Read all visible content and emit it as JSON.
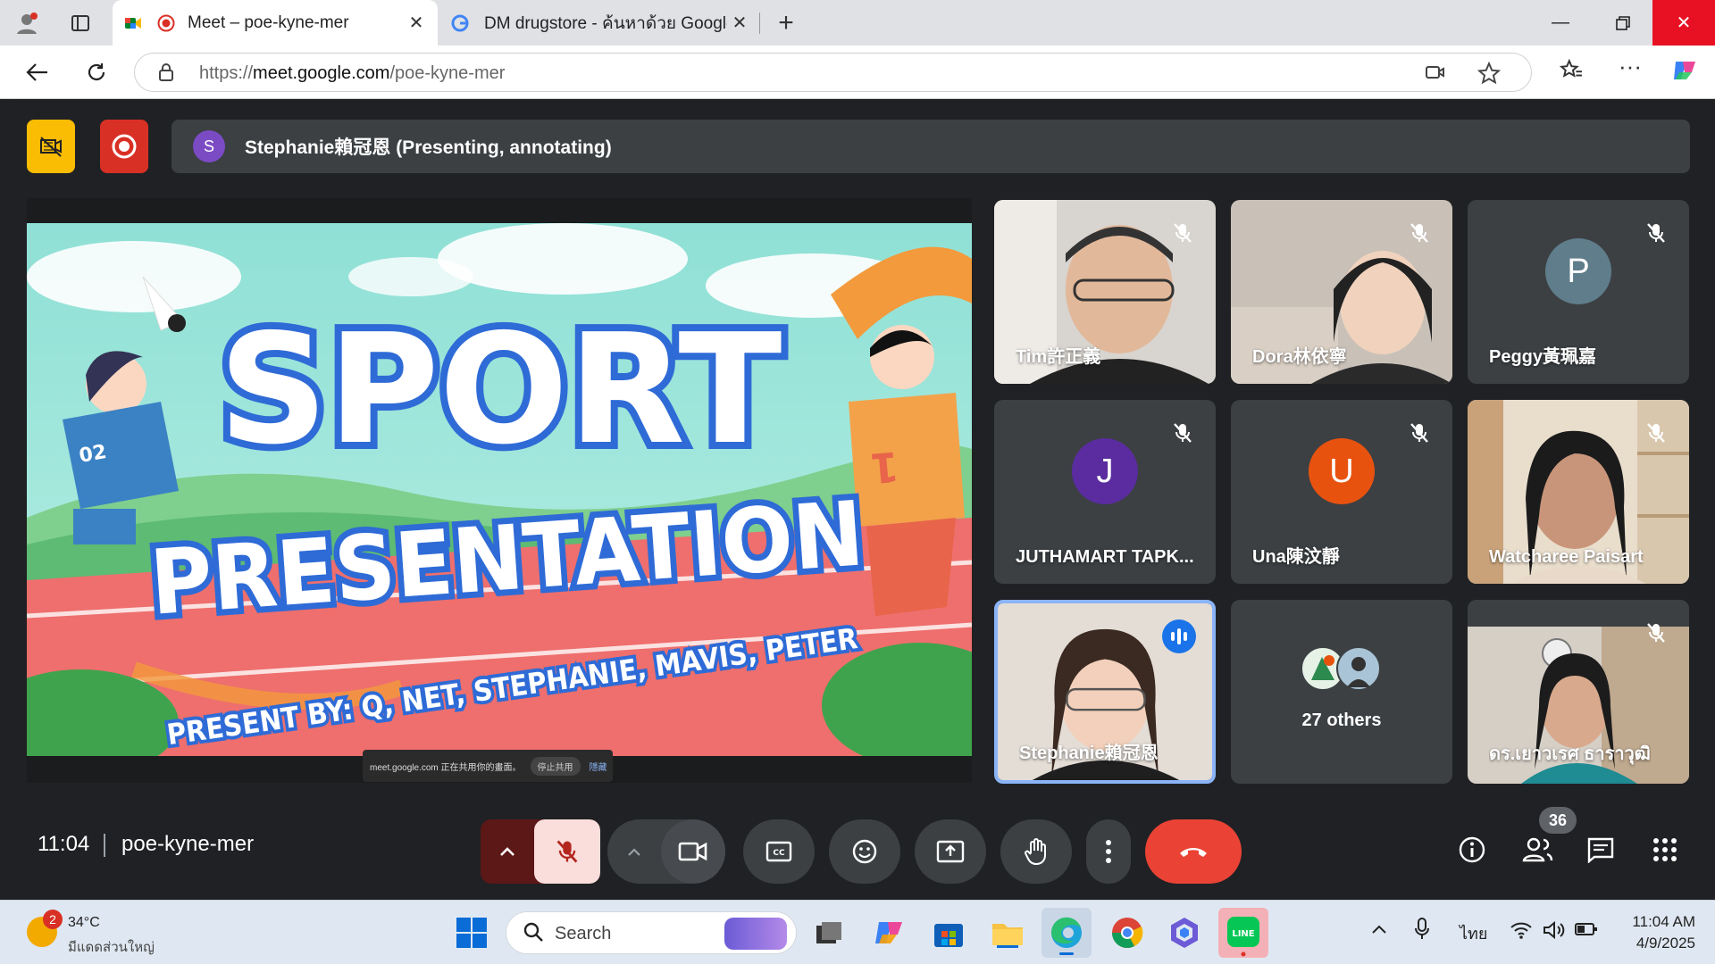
{
  "browser": {
    "tabs": [
      {
        "title": "Meet – poe-kyne-mer",
        "active": true
      },
      {
        "title": "DM drugstore - ค้นหาด้วย Google",
        "active": false
      }
    ],
    "url_prefix": "https://",
    "url_host": "meet.google.com",
    "url_path": "/poe-kyne-mer"
  },
  "meet": {
    "presenter_initial": "S",
    "presenter_text": "Stephanie賴冠恩 (Presenting, annotating)",
    "slide": {
      "title_line1": "SPORT",
      "title_line2": "PRESENTATION",
      "subtitle": "PRESENT BY: Q, NET, STEPHANIE, MAVIS, PETER",
      "bib_left": "02",
      "bib_right": "1"
    },
    "share_banner": {
      "text": "meet.google.com 正在共用你的畫面。",
      "stop": "停止共用",
      "hide": "隱藏"
    },
    "participants": [
      {
        "name": "Tim許正義",
        "type": "video",
        "muted": true
      },
      {
        "name": "Dora林依寧",
        "type": "video",
        "muted": true
      },
      {
        "name": "Peggy黃珮嘉",
        "type": "avatar",
        "initial": "P",
        "color": "#5f7d8b",
        "muted": true
      },
      {
        "name": "JUTHAMART TAPK...",
        "type": "avatar",
        "initial": "J",
        "color": "#5a2ca0",
        "muted": true
      },
      {
        "name": "Una陳汶靜",
        "type": "avatar",
        "initial": "U",
        "color": "#e8520f",
        "muted": true
      },
      {
        "name": "Watcharee Paisart",
        "type": "video",
        "muted": true
      },
      {
        "name": "Stephanie賴冠恩",
        "type": "video",
        "speaking": true
      },
      {
        "name": "27 others",
        "type": "others"
      },
      {
        "name": "ดร.เยาวเรศ ธาราวุฒิ",
        "type": "video",
        "muted": true
      }
    ],
    "time": "11:04",
    "meeting_code": "poe-kyne-mer",
    "people_count": "36",
    "colors": {
      "end_call": "#ea4335",
      "mic_off_bg": "#f9dedc",
      "accent": "#8ab4f8"
    }
  },
  "taskbar": {
    "weather_temp": "34°C",
    "weather_desc": "มีแดดส่วนใหญ่",
    "weather_badge": "2",
    "search_label": "Search",
    "lang": "ไทย",
    "clock_time": "11:04 AM",
    "clock_date": "4/9/2025"
  }
}
